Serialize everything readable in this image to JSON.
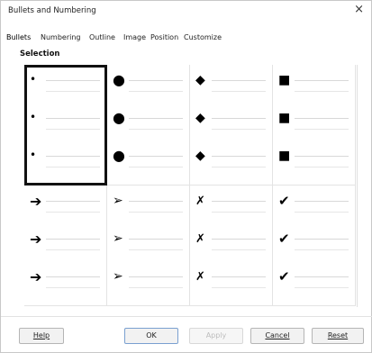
{
  "window": {
    "title": "Bullets and Numbering",
    "close_glyph": "×"
  },
  "tabs": [
    {
      "label": "Bullets",
      "active": true
    },
    {
      "label": "Numbering",
      "active": false
    },
    {
      "label": "Outline",
      "active": false
    },
    {
      "label": "Image",
      "active": false
    },
    {
      "label": "Position",
      "active": false
    },
    {
      "label": "Customize",
      "active": false
    }
  ],
  "section": {
    "label": "Selection"
  },
  "bullet_styles": [
    {
      "glyph": "•",
      "icon": "small-dot-bullet",
      "selected": true
    },
    {
      "glyph": "●",
      "icon": "large-dot-bullet",
      "selected": false
    },
    {
      "glyph": "◆",
      "icon": "diamond-bullet",
      "selected": false
    },
    {
      "glyph": "■",
      "icon": "square-bullet",
      "selected": false
    },
    {
      "glyph": "➔",
      "icon": "arrow-bullet",
      "selected": false
    },
    {
      "glyph": "➢",
      "icon": "arrowhead-bullet",
      "selected": false
    },
    {
      "glyph": "✗",
      "icon": "cross-mark-bullet",
      "selected": false
    },
    {
      "glyph": "✔",
      "icon": "check-mark-bullet",
      "selected": false
    }
  ],
  "buttons": {
    "help": "Help",
    "ok": "OK",
    "apply": "Apply",
    "cancel": "Cancel",
    "reset": "Reset"
  }
}
